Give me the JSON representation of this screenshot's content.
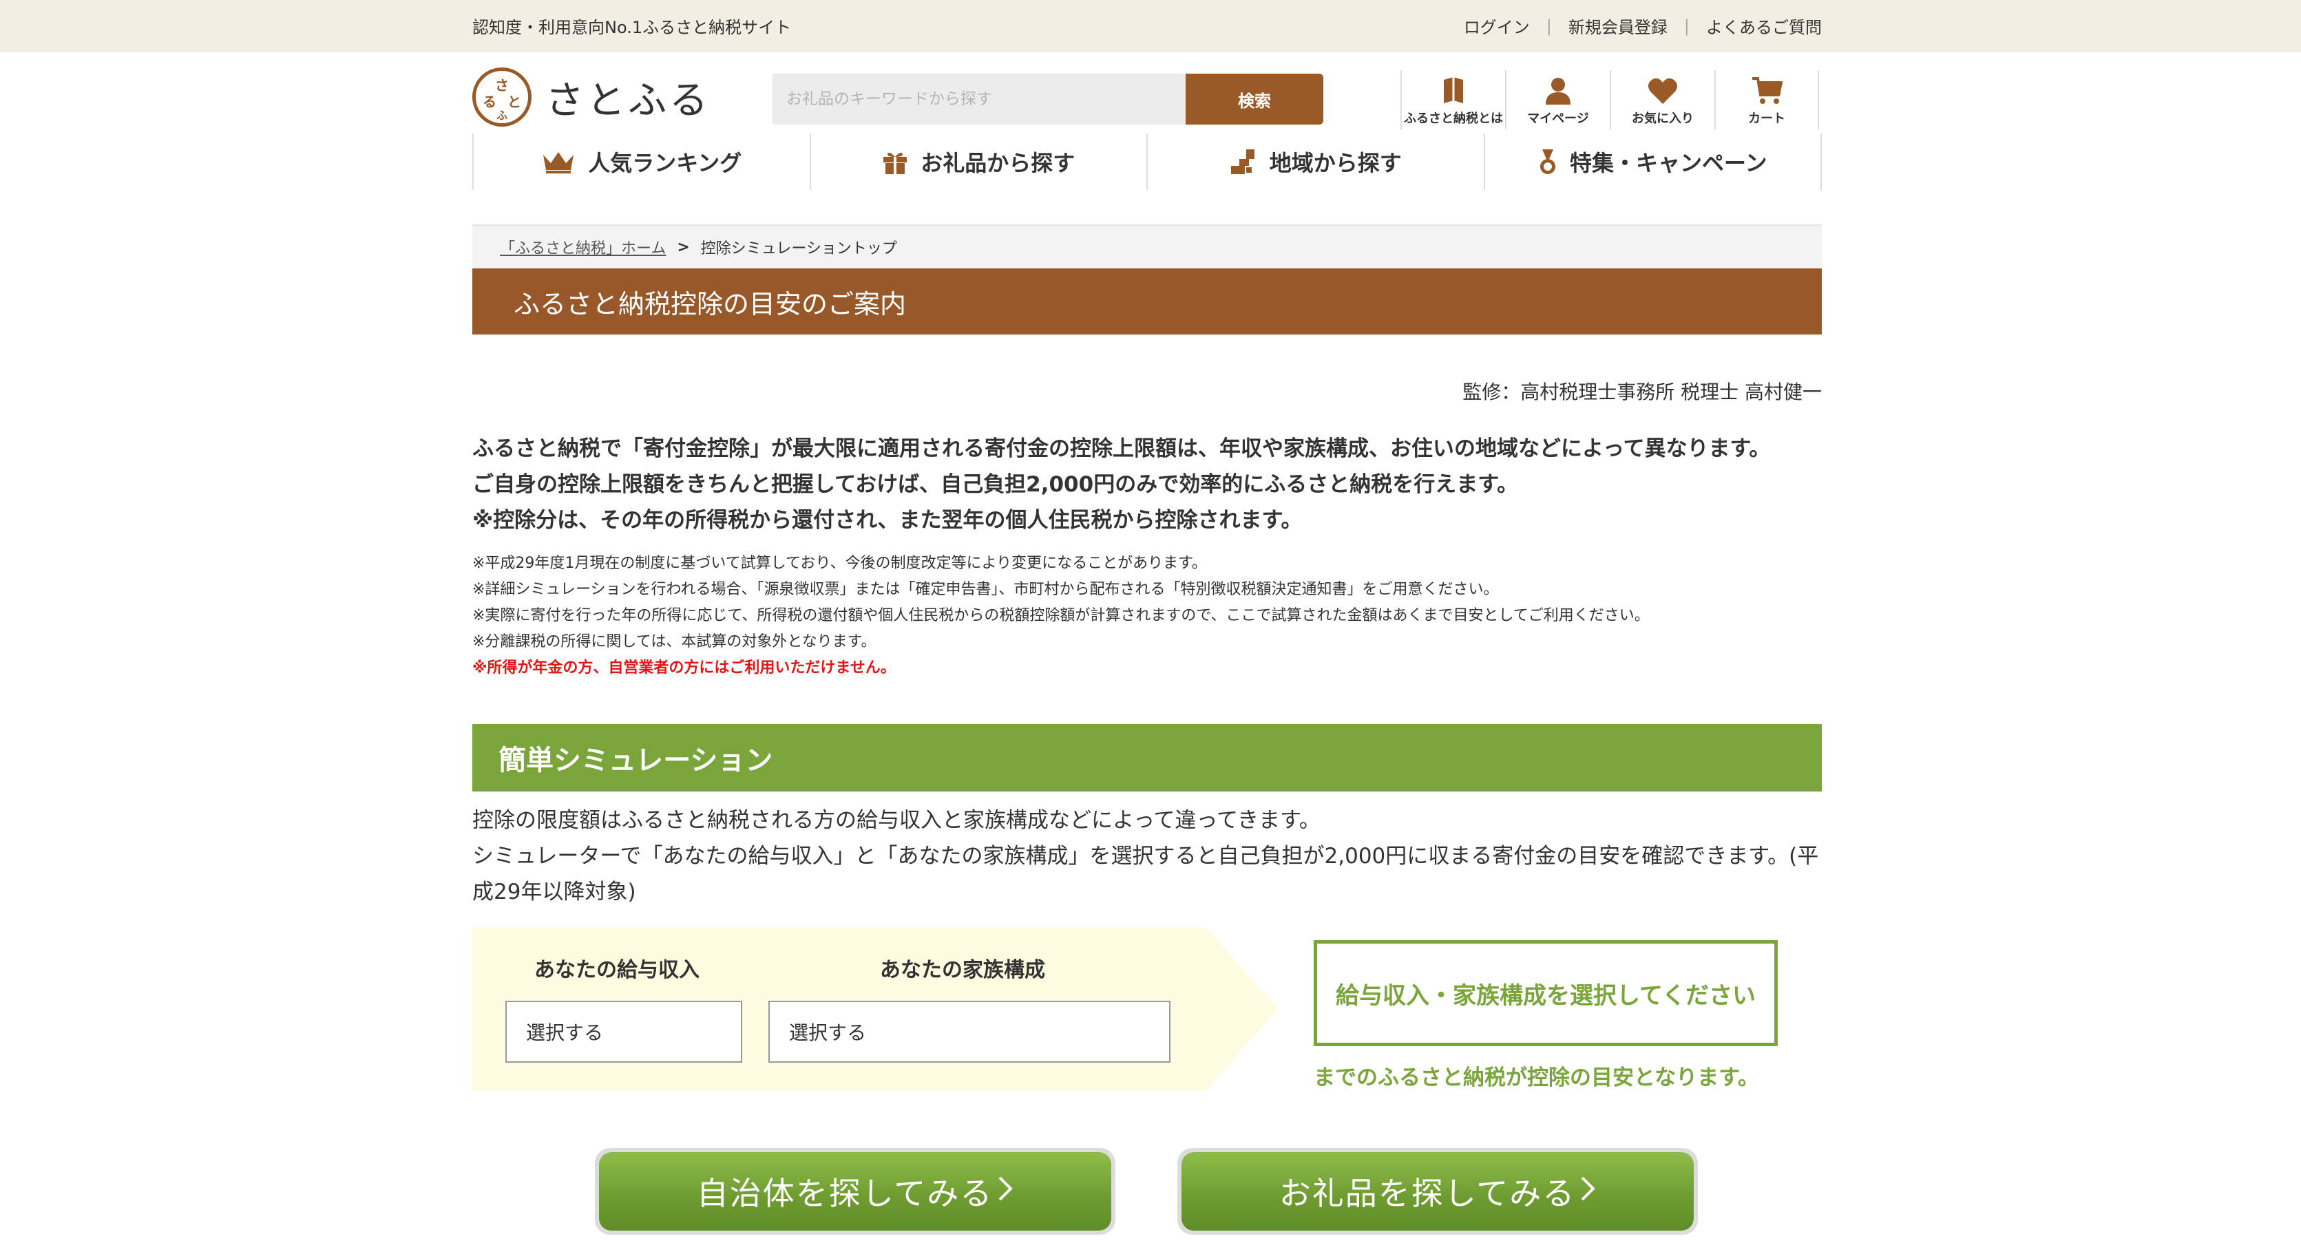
{
  "topbar": {
    "tagline": "認知度・利用意向No.1ふるさと納税サイト",
    "links": [
      "ログイン",
      "新規会員登録",
      "よくあるご質問"
    ]
  },
  "logo": {
    "seal": "さとふる",
    "name": "さとふる"
  },
  "search": {
    "placeholder": "お礼品のキーワードから探す",
    "button": "検索"
  },
  "icon_nav": [
    {
      "label": "ふるさと納税とは",
      "icon": "book-icon"
    },
    {
      "label": "マイページ",
      "icon": "user-icon"
    },
    {
      "label": "お気に入り",
      "icon": "heart-icon"
    },
    {
      "label": "カート",
      "icon": "cart-icon"
    }
  ],
  "main_nav": [
    {
      "label": "人気ランキング",
      "icon": "crown-icon"
    },
    {
      "label": "お礼品から探す",
      "icon": "gift-icon"
    },
    {
      "label": "地域から探す",
      "icon": "region-icon"
    },
    {
      "label": "特集・キャンペーン",
      "icon": "medal-icon"
    }
  ],
  "breadcrumb": {
    "home": "「ふるさと納税」ホーム",
    "separator": ">",
    "current": "控除シミュレーショントップ"
  },
  "page_title": "ふるさと納税控除の目安のご案内",
  "supervisor": "監修：高村税理士事務所 税理士 高村健一",
  "intro": [
    "ふるさと納税で「寄付金控除」が最大限に適用される寄付金の控除上限額は、年収や家族構成、お住いの地域などによって異なります。",
    "ご自身の控除上限額をきちんと把握しておけば、自己負担2,000円のみで効率的にふるさと納税を行えます。",
    "※控除分は、その年の所得税から還付され、また翌年の個人住民税から控除されます。"
  ],
  "notes": [
    "※平成29年度1月現在の制度に基づいて試算しており、今後の制度改定等により変更になることがあります。",
    "※詳細シミュレーションを行われる場合、「源泉徴収票」または「確定申告書」、市町村から配布される「特別徴収税額決定通知書」をご用意ください。",
    "※実際に寄付を行った年の所得に応じて、所得税の還付額や個人住民税からの税額控除額が計算されますので、ここで試算された金額はあくまで目安としてご利用ください。",
    "※分離課税の所得に関しては、本試算の対象外となります。"
  ],
  "warning": "※所得が年金の方、自営業者の方にはご利用いただけません。",
  "simulation": {
    "heading": "簡単シミュレーション",
    "desc_line1": "控除の限度額はふるさと納税される方の給与収入と家族構成などによって違ってきます。",
    "desc_line2": "シミュレーターで「あなたの給与収入」と「あなたの家族構成」を選択すると自己負担が2,000円に収まる寄付金の目安を確認できます。(平成29年以降対象)",
    "income_label": "あなたの給与収入",
    "income_value": "選択する",
    "family_label": "あなたの家族構成",
    "family_value": "選択する",
    "result_prompt": "給与収入・家族構成を選択してください",
    "result_note": "までのふるさと納税が控除の目安となります。"
  },
  "buttons": {
    "municipality": "自治体を探してみる",
    "gifts": "お礼品を探してみる"
  },
  "colors": {
    "brand_brown": "#98582a",
    "sim_green": "#7aa53a",
    "warning_red": "#e61414",
    "cream": "#fdfbe0",
    "top_bar": "#f3eee3"
  }
}
